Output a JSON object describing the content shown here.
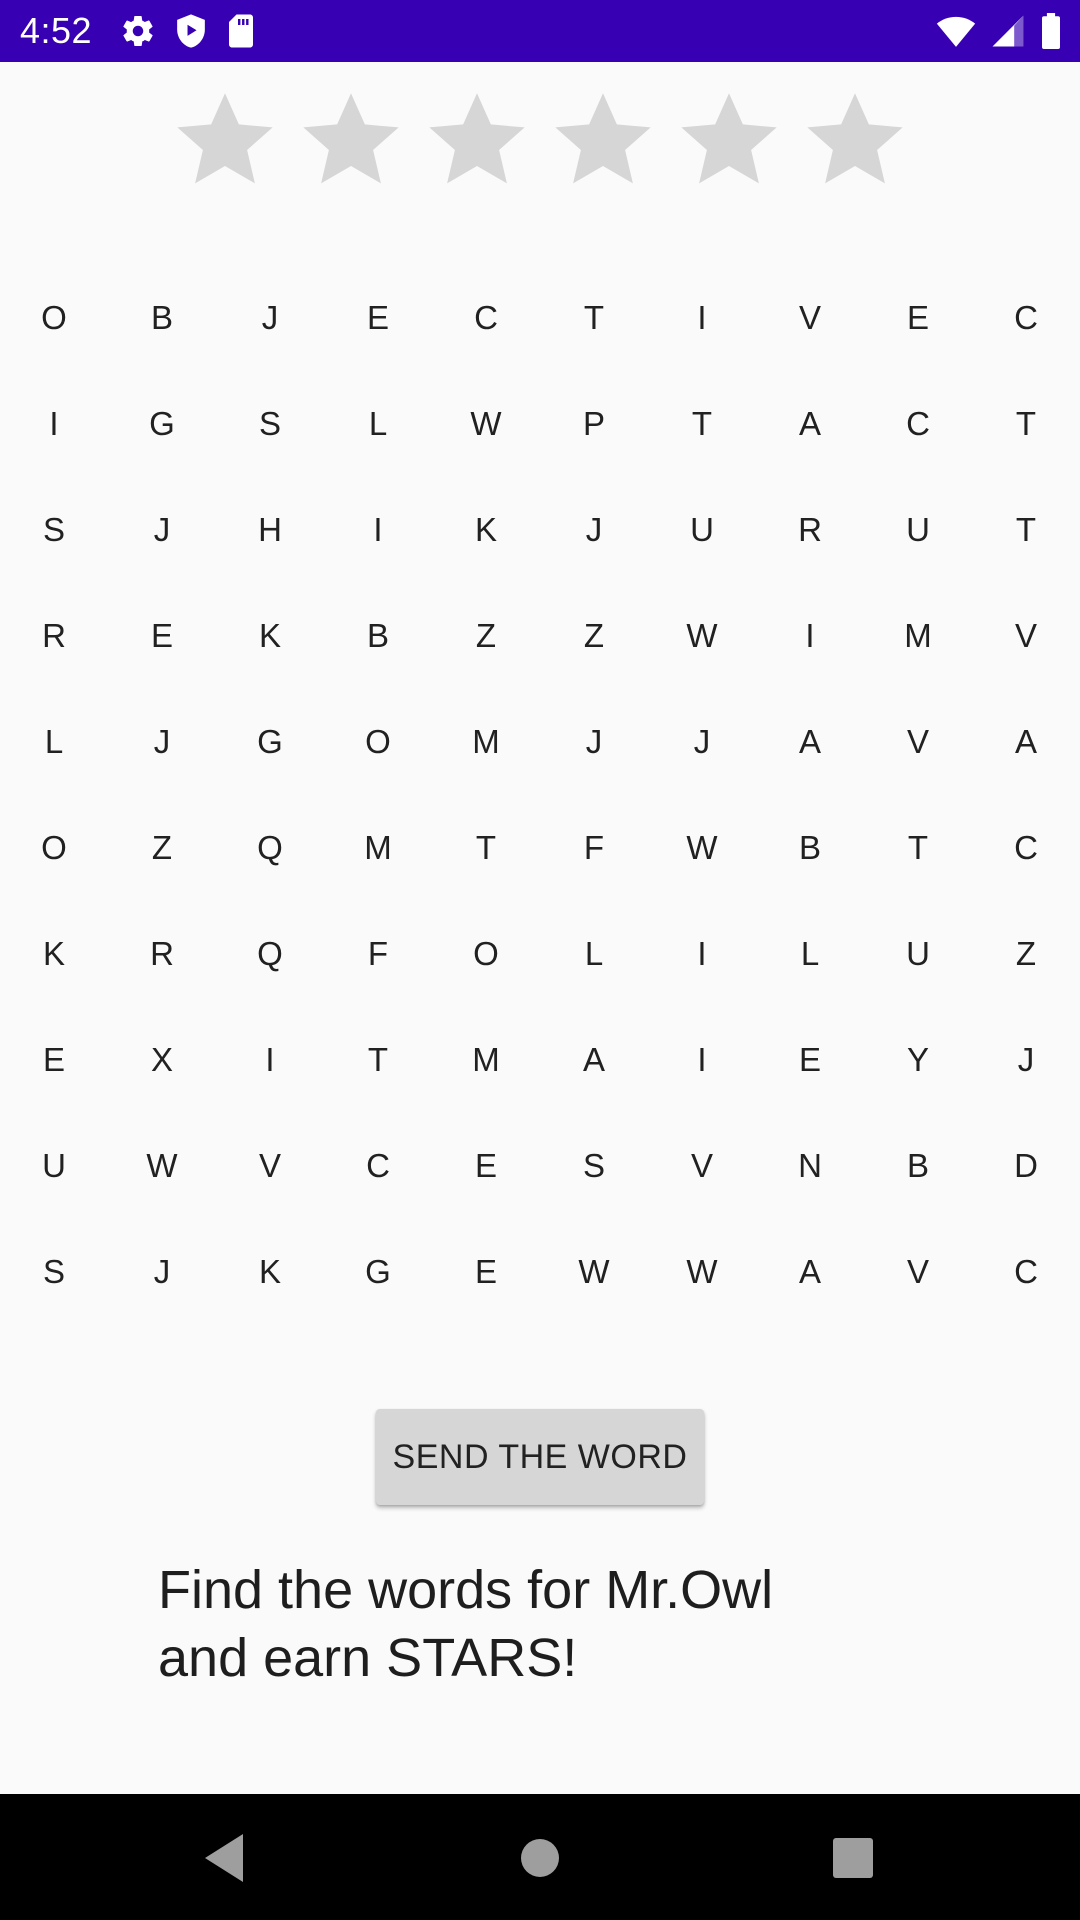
{
  "status_bar": {
    "time": "4:52",
    "left_icons": [
      "gear-icon",
      "shield-play-icon",
      "sd-card-icon"
    ],
    "right_icons": [
      "wifi-icon",
      "cell-signal-icon",
      "battery-icon"
    ],
    "background_color": "#3700b3"
  },
  "stars": {
    "total": 6,
    "earned": 0,
    "empty_color": "#d6d6d6"
  },
  "grid": {
    "rows": [
      [
        "O",
        "B",
        "J",
        "E",
        "C",
        "T",
        "I",
        "V",
        "E",
        "C"
      ],
      [
        "I",
        "G",
        "S",
        "L",
        "W",
        "P",
        "T",
        "A",
        "C",
        "T"
      ],
      [
        "S",
        "J",
        "H",
        "I",
        "K",
        "J",
        "U",
        "R",
        "U",
        "T"
      ],
      [
        "R",
        "E",
        "K",
        "B",
        "Z",
        "Z",
        "W",
        "I",
        "M",
        "V"
      ],
      [
        "L",
        "J",
        "G",
        "O",
        "M",
        "J",
        "J",
        "A",
        "V",
        "A"
      ],
      [
        "O",
        "Z",
        "Q",
        "M",
        "T",
        "F",
        "W",
        "B",
        "T",
        "C"
      ],
      [
        "K",
        "R",
        "Q",
        "F",
        "O",
        "L",
        "I",
        "L",
        "U",
        "Z"
      ],
      [
        "E",
        "X",
        "I",
        "T",
        "M",
        "A",
        "I",
        "E",
        "Y",
        "J"
      ],
      [
        "U",
        "W",
        "V",
        "C",
        "E",
        "S",
        "V",
        "N",
        "B",
        "D"
      ],
      [
        "S",
        "J",
        "K",
        "G",
        "E",
        "W",
        "W",
        "A",
        "V",
        "C"
      ]
    ]
  },
  "send_button": {
    "label": "SEND THE WORD"
  },
  "instruction": {
    "line1": "Find the words for Mr.Owl",
    "line2": "and earn STARS!"
  },
  "nav_bar": {
    "buttons": [
      "back-icon",
      "home-icon",
      "recents-icon"
    ]
  }
}
